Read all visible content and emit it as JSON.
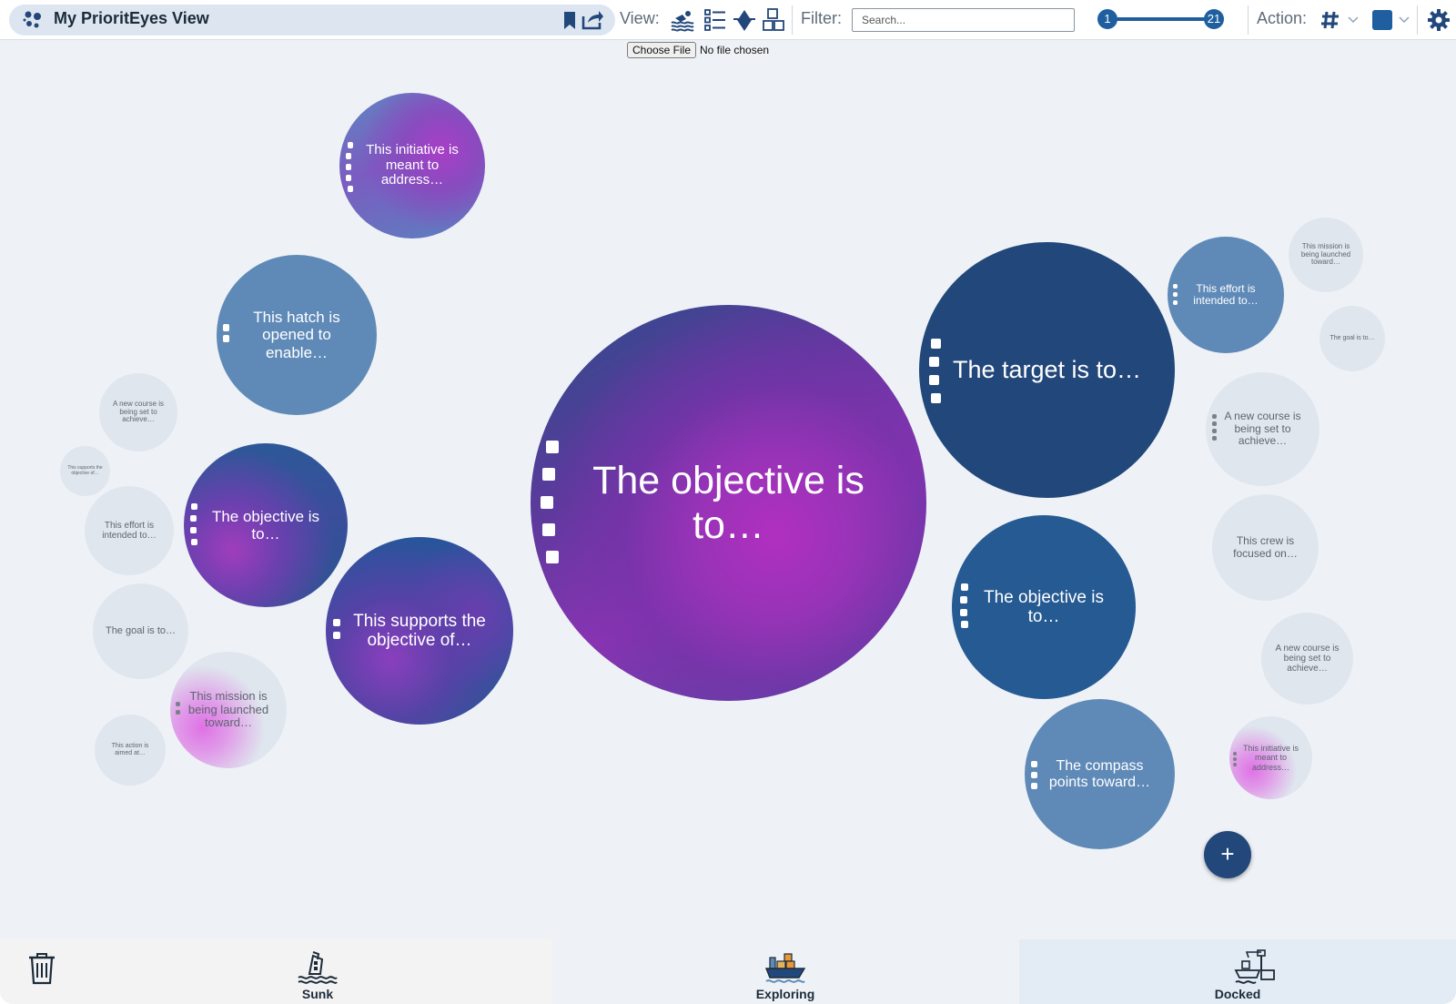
{
  "header": {
    "title": "My PrioritEyes View",
    "view_label": "View:",
    "filter_label": "Filter:",
    "search_placeholder": "Search...",
    "action_label": "Action:",
    "slider": {
      "min": "1",
      "max": "21"
    },
    "icons": [
      "app-logo-icon",
      "bookmark-icon",
      "share-icon",
      "swimmers-icon",
      "list-icon",
      "iceberg-icon",
      "blocks-icon",
      "hash-icon",
      "chevron-down-icon",
      "color-swatch",
      "gear-icon"
    ],
    "accent_color": "#1f5fa0"
  },
  "file_input": {
    "button": "Choose File",
    "status": "No file chosen"
  },
  "bubbles": {
    "center": "The objective is to…",
    "initiative_top": "This initiative is meant to address…",
    "hatch": "This hatch is opened to enable…",
    "objective_left": "The objective is to…",
    "supports": "This supports the objective of…",
    "target": "The target is to…",
    "objective_right": "The objective is to…",
    "compass": "The compass points toward…",
    "effort_right": "This effort is intended to…",
    "mission_far_right": "This mission is being launched toward…",
    "goal_far_right": "The goal is to…",
    "course_right": "A new course is being set to achieve…",
    "crew": "This crew is focused on…",
    "course_far_right": "A new course is being set to achieve…",
    "initiative_pink": "This initiative is meant to address…",
    "course_left": "A new course is being set to achieve…",
    "supports_tiny": "This supports the objective of…",
    "effort_left": "This effort is intended to…",
    "goal_left": "The goal is to…",
    "mission_pink": "This mission is being launched toward…",
    "action_small": "This action is aimed at…"
  },
  "add_button": "+",
  "footer": {
    "trash_icon": "trash-icon",
    "zones": [
      {
        "label": "Sunk",
        "icon": "sinking-ship-icon"
      },
      {
        "label": "Exploring",
        "icon": "cargo-ship-icon"
      },
      {
        "label": "Docked",
        "icon": "docked-ship-icon"
      }
    ]
  },
  "colors": {
    "background": "#eef2f6",
    "dark_navy": "#22477a",
    "mid_blue": "#5f8ab8",
    "pale": "#dfe6ee",
    "magenta": "#b12fbf",
    "docked_highlight": "#e3ebf5"
  }
}
